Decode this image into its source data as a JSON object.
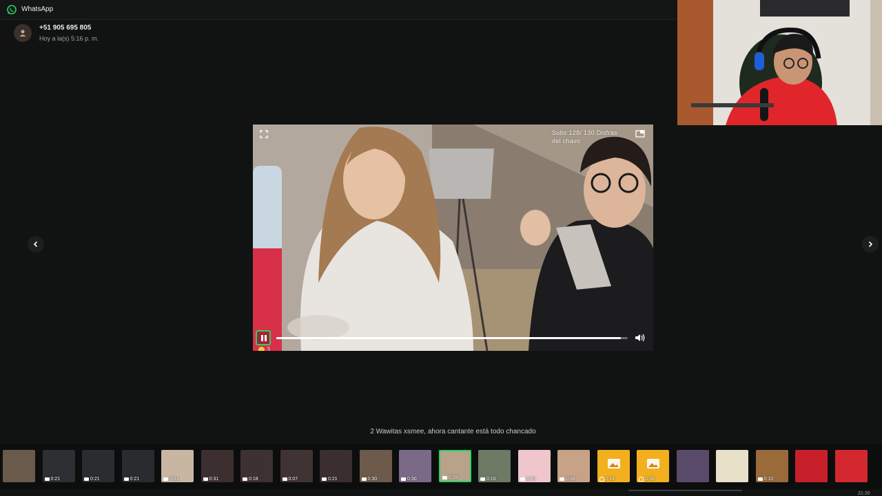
{
  "app": {
    "title": "WhatsApp"
  },
  "header": {
    "contact_name": "+51 905 695 805",
    "timestamp": "Hoy a la(s) 5:16 p. m."
  },
  "video": {
    "overlay_caption": "Subs:128/ 130 Disfras del chavo",
    "progress": 0.98,
    "reaction": {
      "emoji_icon": "laughing-emoji-icon",
      "count": "3"
    }
  },
  "caption": "2 Wawitas xsmee, ahora cantante está todo chancado",
  "thumbnails": [
    {
      "type": "image",
      "duration": ""
    },
    {
      "type": "video",
      "duration": "0:21"
    },
    {
      "type": "video",
      "duration": "0:21"
    },
    {
      "type": "video",
      "duration": "0:21"
    },
    {
      "type": "video",
      "duration": "0:31"
    },
    {
      "type": "video",
      "duration": "0:31"
    },
    {
      "type": "video",
      "duration": "0:18"
    },
    {
      "type": "video",
      "duration": "0:07"
    },
    {
      "type": "video",
      "duration": "0:21"
    },
    {
      "type": "video",
      "duration": "0:30"
    },
    {
      "type": "video",
      "duration": "0:30"
    },
    {
      "type": "video",
      "duration": "0:28"
    },
    {
      "type": "video",
      "duration": "0:16"
    },
    {
      "type": "video",
      "duration": "0:43"
    },
    {
      "type": "video",
      "duration": "0:36"
    },
    {
      "type": "audio",
      "duration": "0:14"
    },
    {
      "type": "audio",
      "duration": "0:38"
    },
    {
      "type": "image",
      "duration": ""
    },
    {
      "type": "image",
      "duration": ""
    },
    {
      "type": "video",
      "duration": "0:10"
    },
    {
      "type": "image",
      "duration": ""
    },
    {
      "type": "image",
      "duration": ""
    }
  ],
  "active_thumbnail_index": 11,
  "tray": {
    "clock": "21:20"
  },
  "colors": {
    "accent": "#25d366",
    "background": "#111313"
  }
}
